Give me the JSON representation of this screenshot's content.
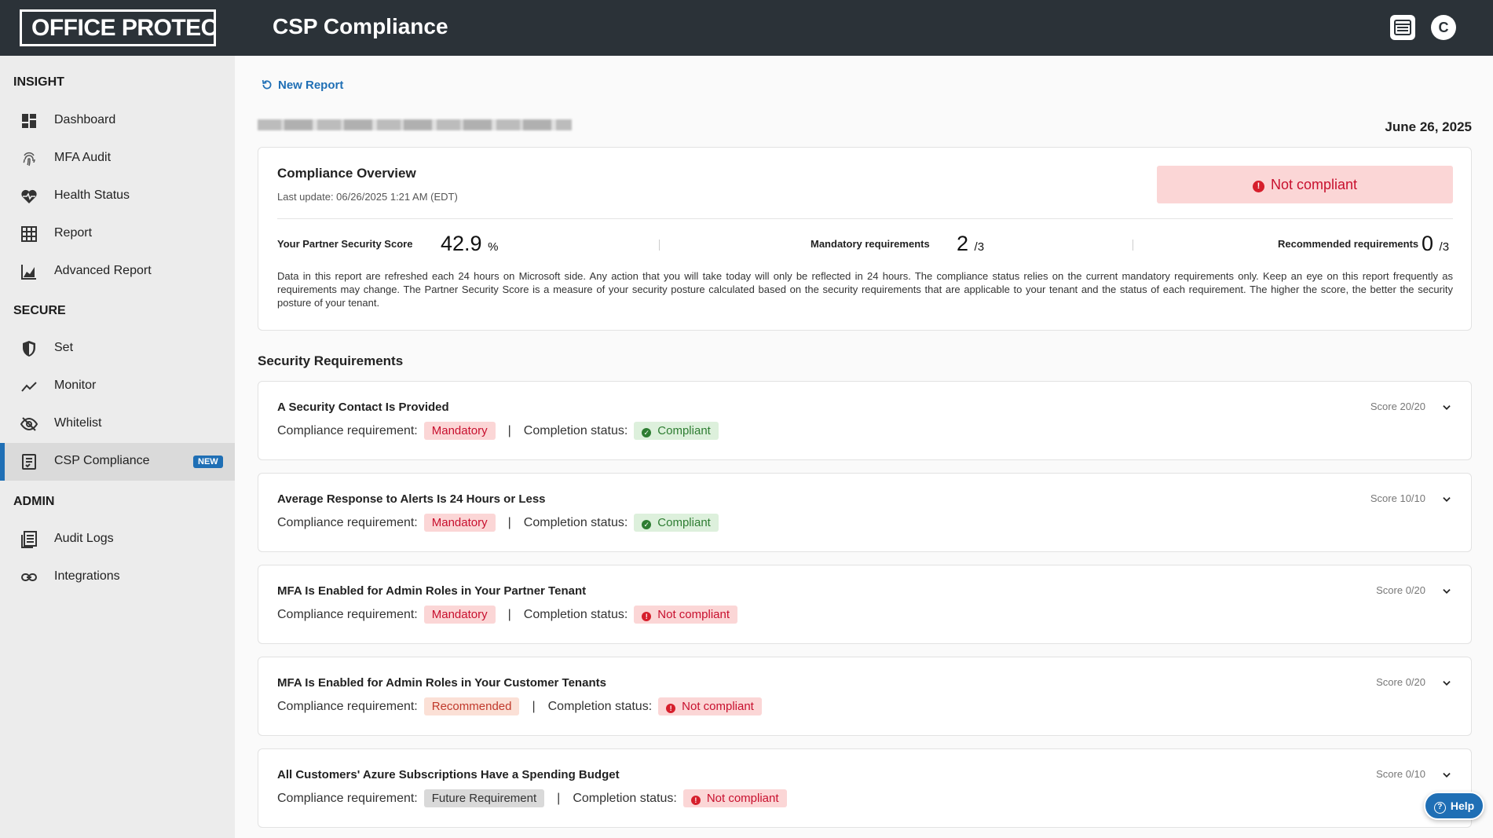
{
  "header": {
    "logo_text": "OFFICE PROTECT",
    "title": "CSP Compliance",
    "avatar_initial": "C"
  },
  "sidebar": {
    "sections": [
      {
        "label": "INSIGHT"
      },
      {
        "label": "SECURE"
      },
      {
        "label": "ADMIN"
      }
    ],
    "items": [
      {
        "label": "Dashboard",
        "icon": "dashboard-icon"
      },
      {
        "label": "MFA Audit",
        "icon": "fingerprint-icon"
      },
      {
        "label": "Health Status",
        "icon": "heart-pulse-icon"
      },
      {
        "label": "Report",
        "icon": "grid-table-icon"
      },
      {
        "label": "Advanced Report",
        "icon": "area-chart-icon"
      },
      {
        "label": "Set",
        "icon": "shield-icon"
      },
      {
        "label": "Monitor",
        "icon": "trend-line-icon"
      },
      {
        "label": "Whitelist",
        "icon": "eye-off-icon"
      },
      {
        "label": "CSP Compliance",
        "icon": "checklist-icon",
        "badge": "NEW",
        "active": true
      },
      {
        "label": "Audit Logs",
        "icon": "document-list-icon"
      },
      {
        "label": "Integrations",
        "icon": "link-icon"
      }
    ]
  },
  "main": {
    "new_report": "New Report",
    "tenant_name": "████████ • ██ - ███████████████████",
    "report_date": "June 26, 2025",
    "overview": {
      "title": "Compliance Overview",
      "last_update": "Last update: 06/26/2025 1:21 AM (EDT)",
      "status": "Not compliant",
      "score_label": "Your Partner Security Score",
      "score_value": "42.9",
      "score_unit": "%",
      "mandatory_label": "Mandatory requirements",
      "mandatory_value": "2",
      "mandatory_total": "/3",
      "recommended_label": "Recommended requirements",
      "recommended_value": "0",
      "recommended_total": "/3",
      "description": "Data in this report are refreshed each 24 hours on Microsoft side. Any action that you will take today will only be reflected in 24 hours. The compliance status relies on the current mandatory requirements only. Keep an eye on this report frequently as requirements may change. The Partner Security Score is a measure of your security posture calculated based on the security requirements that are applicable to your tenant and the status of each requirement. The higher the score, the better the security posture of your tenant."
    },
    "requirements_title": "Security Requirements",
    "requirement_label": "Compliance requirement:",
    "status_label": "Completion status:",
    "requirements": [
      {
        "title": "A Security Contact Is Provided",
        "requirement": "Mandatory",
        "status": "Compliant",
        "score": "Score 20/20"
      },
      {
        "title": "Average Response to Alerts Is 24 Hours or Less",
        "requirement": "Mandatory",
        "status": "Compliant",
        "score": "Score 10/10"
      },
      {
        "title": "MFA Is Enabled for Admin Roles in Your Partner Tenant",
        "requirement": "Mandatory",
        "status": "Not compliant",
        "score": "Score 0/20"
      },
      {
        "title": "MFA Is Enabled for Admin Roles in Your Customer Tenants",
        "requirement": "Recommended",
        "status": "Not compliant",
        "score": "Score 0/20"
      },
      {
        "title": "All Customers' Azure Subscriptions Have a Spending Budget",
        "requirement": "Future Requirement",
        "status": "Not compliant",
        "score": "Score 0/10"
      }
    ]
  },
  "help": {
    "label": "Help"
  },
  "colors": {
    "topbar": "#2b3238",
    "accent": "#1f6fb5",
    "danger": "#c8102e",
    "success": "#2e7d32"
  }
}
